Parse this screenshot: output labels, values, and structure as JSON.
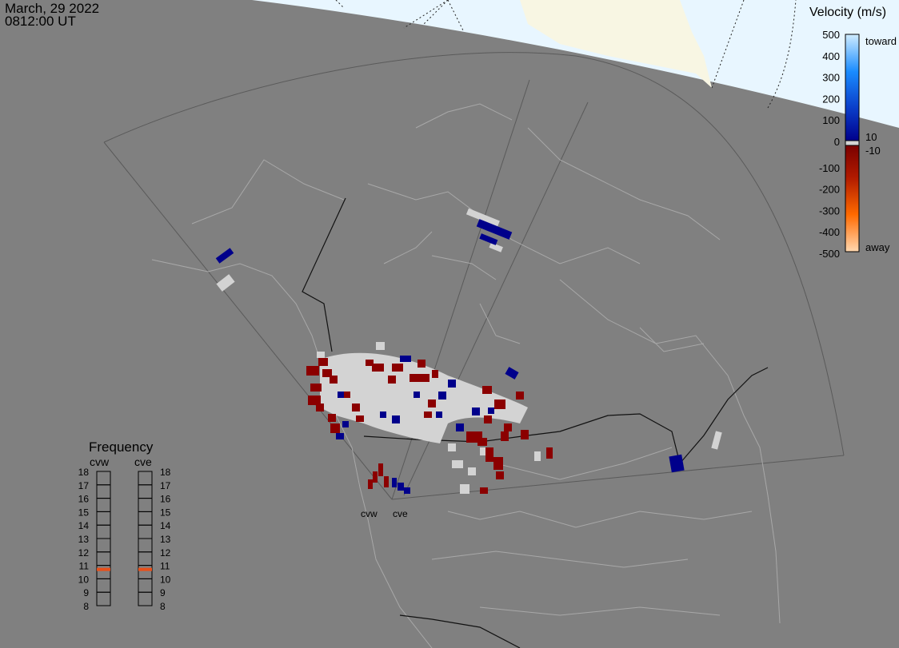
{
  "header": {
    "date": "March, 29 2022",
    "time": "0812:00 UT"
  },
  "colorbar": {
    "title": "Velocity (m/s)",
    "ticks": [
      "500",
      "400",
      "300",
      "200",
      "100",
      "0",
      "-100",
      "-200",
      "-300",
      "-400",
      "-500"
    ],
    "label_toward": "toward",
    "label_away": "away",
    "label_pos_min": "10",
    "label_neg_min": "-10",
    "colors": {
      "toward_max": "#d0ecff",
      "toward_mid": "#1a8cff",
      "toward_min": "#00008b",
      "away_min": "#7a0000",
      "away_mid": "#ff6a00",
      "away_max": "#ffd8b0",
      "ground_scatter": "#d3d3d3"
    }
  },
  "frequency": {
    "title": "Frequency",
    "radars": [
      "cvw",
      "cve"
    ],
    "scale": [
      "18",
      "17",
      "16",
      "15",
      "14",
      "13",
      "12",
      "11",
      "10",
      "9",
      "8"
    ],
    "value_mhz": 10.7,
    "marker_color": "#e8501a"
  },
  "radars": {
    "west_label": "cvw",
    "east_label": "cve"
  }
}
